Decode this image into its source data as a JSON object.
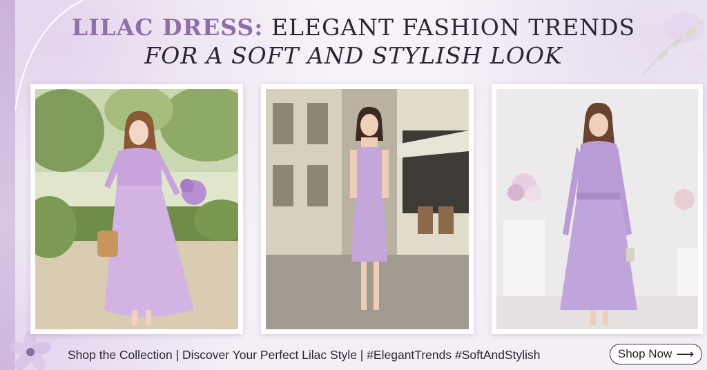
{
  "headline": {
    "accent": "LILAC DRESS:",
    "rest": " ELEGANT FASHION TRENDS",
    "line2": "FOR A SOFT AND STYLISH LOOK"
  },
  "photos": [
    {
      "subject": "Woman in floral lilac chiffon midi dress holding lilac bouquet and straw bag in a garden"
    },
    {
      "subject": "Woman in lilac satin slip dress with side slit on a city street"
    },
    {
      "subject": "Woman in lilac pleated belted midi dress in a white studio with flowers"
    }
  ],
  "footer": {
    "tagline": "Shop the Collection | Discover Your Perfect Lilac Style | #ElegantTrends #SoftAndStylish",
    "button_label": "Shop Now",
    "button_arrow": "⟶"
  },
  "colors": {
    "accent": "#8e6fa8",
    "lilac": "#c3a6dc",
    "background": "#f6f1f8"
  }
}
